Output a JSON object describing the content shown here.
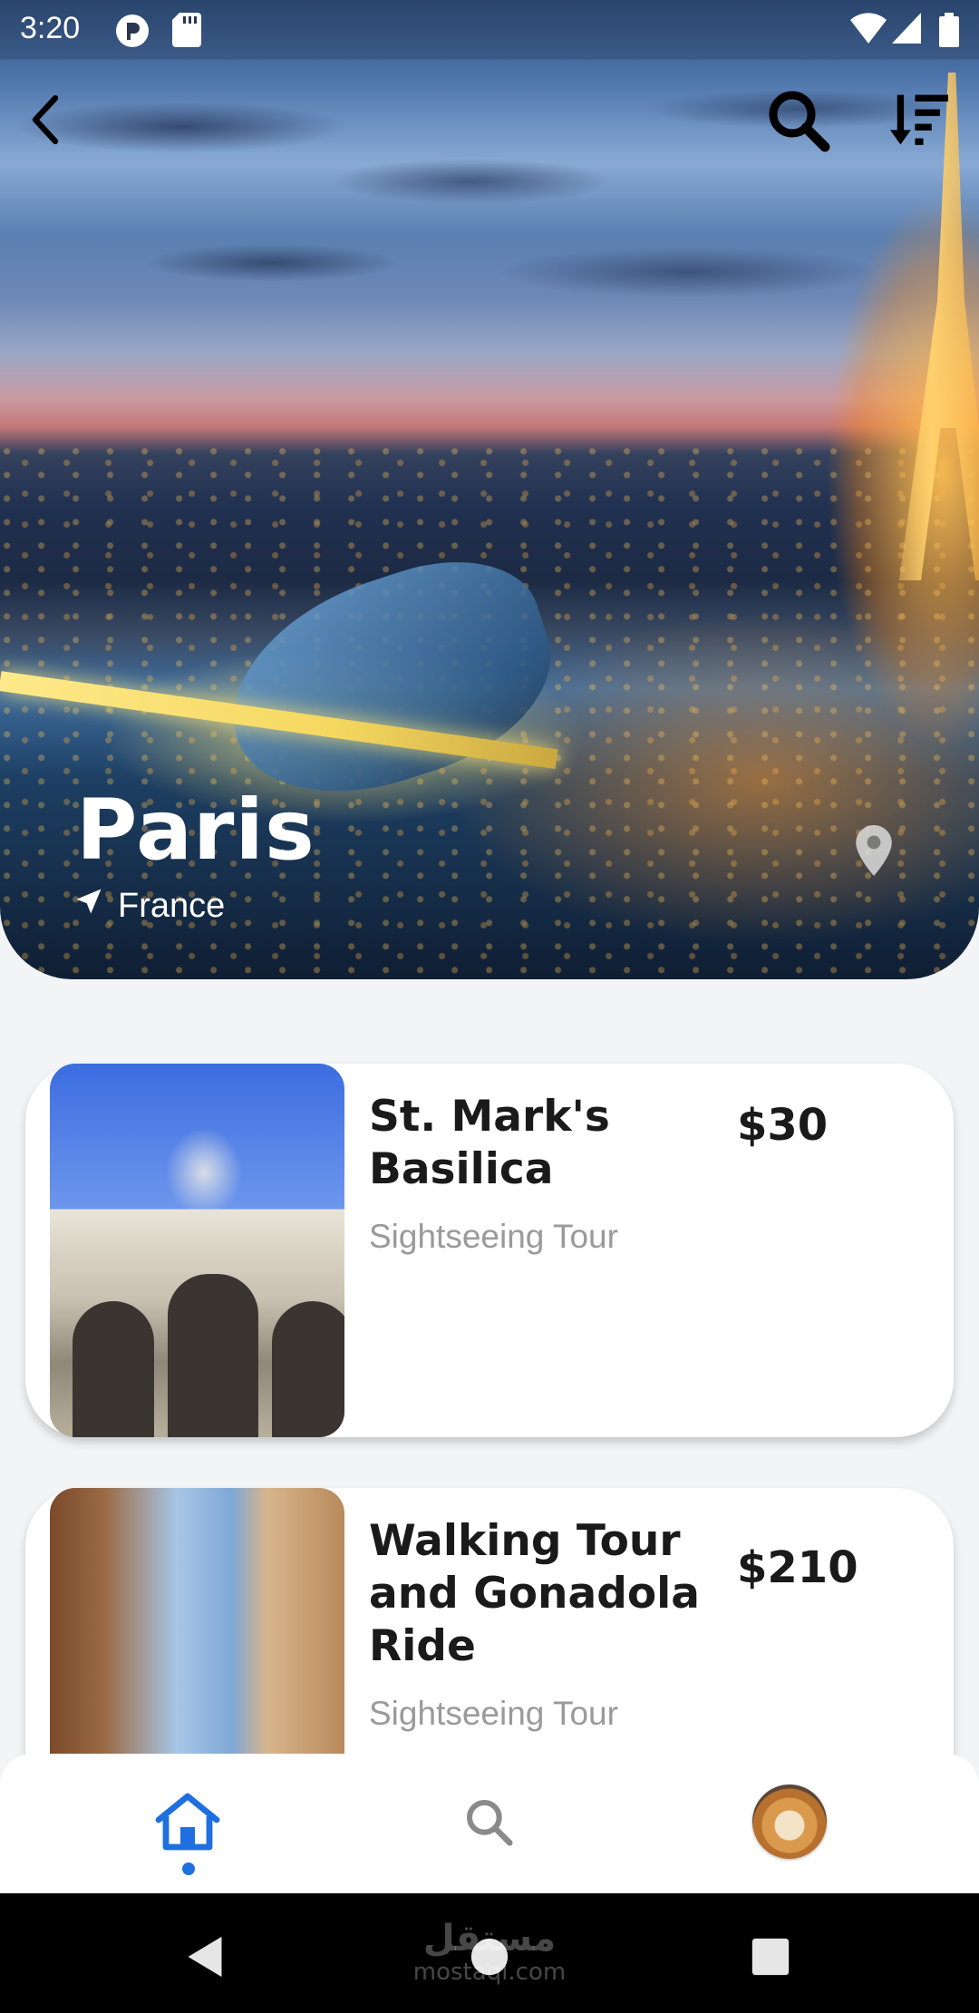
{
  "status_bar": {
    "time": "3:20"
  },
  "destination": {
    "city": "Paris",
    "country": "France"
  },
  "tours": [
    {
      "name_line1": "St. Mark's",
      "name_line2": "Basilica",
      "name_line3": "",
      "type": "Sightseeing Tour",
      "price": "$30"
    },
    {
      "name_line1": "Walking Tour",
      "name_line2": "and Gonadola",
      "name_line3": "Ride",
      "type": "Sightseeing Tour",
      "price": "$210"
    }
  ],
  "watermark": {
    "arabic": "مستقل",
    "latin": "mostaql.com"
  },
  "colors": {
    "accent": "#1E6FE0",
    "background": "#F2F4F6",
    "card": "#FFFFFF"
  }
}
